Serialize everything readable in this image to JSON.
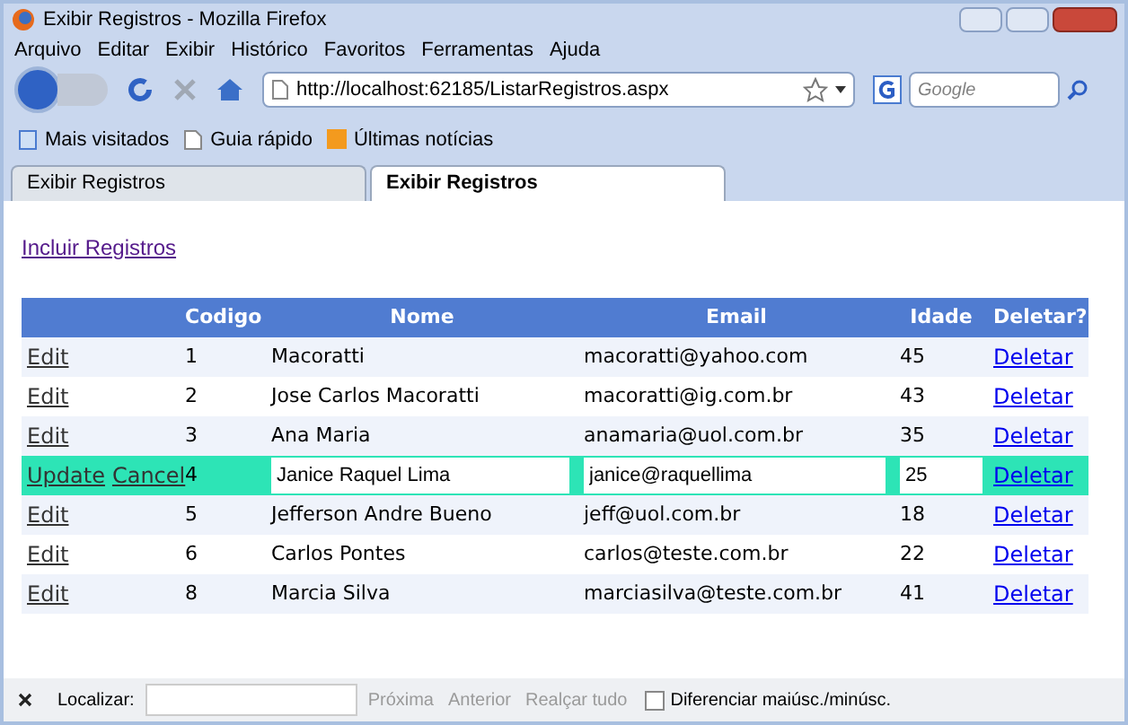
{
  "window": {
    "title": "Exibir Registros - Mozilla Firefox"
  },
  "menu": [
    "Arquivo",
    "Editar",
    "Exibir",
    "Histórico",
    "Favoritos",
    "Ferramentas",
    "Ajuda"
  ],
  "address": {
    "value": "http://localhost:62185/ListarRegistros.aspx"
  },
  "search": {
    "placeholder": "Google"
  },
  "bookmarks": [
    "Mais visitados",
    "Guia rápido",
    "Últimas notícias"
  ],
  "tabs": [
    {
      "label": "Exibir Registros",
      "selected": false
    },
    {
      "label": "Exibir Registros",
      "selected": true
    }
  ],
  "page": {
    "link": "Incluir Registros",
    "table": {
      "columns": [
        "",
        "Codigo",
        "Nome",
        "Email",
        "Idade",
        "Deletar?"
      ],
      "rows": [
        {
          "editing": false,
          "actions": [
            "Edit"
          ],
          "codigo": "1",
          "nome": "Macoratti",
          "email": "macoratti@yahoo.com",
          "idade": "45",
          "delete": "Deletar"
        },
        {
          "editing": false,
          "actions": [
            "Edit"
          ],
          "codigo": "2",
          "nome": "Jose Carlos Macoratti",
          "email": "macoratti@ig.com.br",
          "idade": "43",
          "delete": "Deletar"
        },
        {
          "editing": false,
          "actions": [
            "Edit"
          ],
          "codigo": "3",
          "nome": "Ana Maria",
          "email": "anamaria@uol.com.br",
          "idade": "35",
          "delete": "Deletar"
        },
        {
          "editing": true,
          "actions": [
            "Update",
            "Cancel"
          ],
          "codigo": "4",
          "nome": "Janice Raquel Lima",
          "email": "janice@raquellima",
          "idade": "25",
          "delete": "Deletar"
        },
        {
          "editing": false,
          "actions": [
            "Edit"
          ],
          "codigo": "5",
          "nome": "Jefferson Andre Bueno",
          "email": "jeff@uol.com.br",
          "idade": "18",
          "delete": "Deletar"
        },
        {
          "editing": false,
          "actions": [
            "Edit"
          ],
          "codigo": "6",
          "nome": "Carlos Pontes",
          "email": "carlos@teste.com.br",
          "idade": "22",
          "delete": "Deletar"
        },
        {
          "editing": false,
          "actions": [
            "Edit"
          ],
          "codigo": "8",
          "nome": "Marcia Silva",
          "email": "marciasilva@teste.com.br",
          "idade": "41",
          "delete": "Deletar"
        }
      ]
    }
  },
  "find_bar": {
    "label": "Localizar:",
    "buttons": [
      "Próxima",
      "Anterior",
      "Realçar tudo"
    ],
    "match_case": {
      "label": "Diferenciar maiúsc./minúsc.",
      "checked": false
    }
  }
}
